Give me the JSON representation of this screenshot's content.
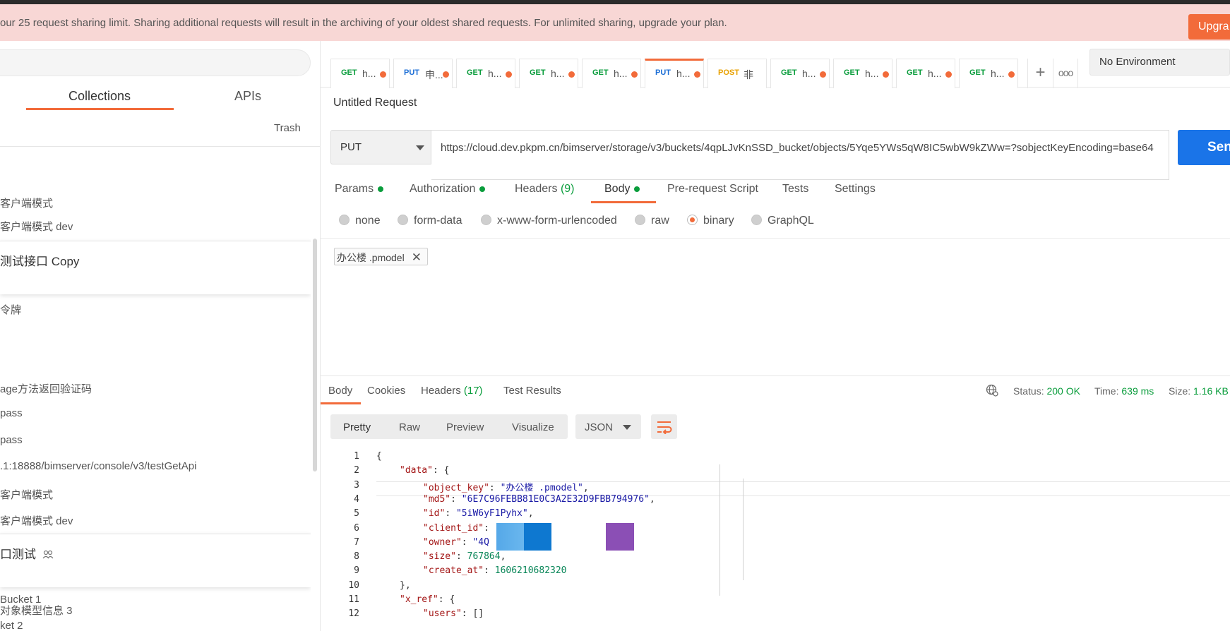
{
  "banner": {
    "text": "our 25 request sharing limit. Sharing additional requests will result in the archiving of your oldest shared requests. For unlimited sharing, upgrade your plan.",
    "upgrade_label": "Upgra"
  },
  "sidebar": {
    "tabs": [
      "Collections",
      "APIs"
    ],
    "trash_label": "Trash",
    "items": [
      "客户端模式",
      "客户端模式 dev",
      "令牌",
      "age方法返回验证码",
      "pass",
      "pass",
      ".1:18888/bimserver/console/v3/testGetApi",
      "客户端模式",
      "客户端模式 dev",
      "Bucket 1",
      "ket 2",
      "对象模型信息 3"
    ],
    "groups": [
      "测试接口 Copy",
      "口测试"
    ]
  },
  "tabs": {
    "items": [
      {
        "method": "GET",
        "title": "h..."
      },
      {
        "method": "PUT",
        "title": "申..."
      },
      {
        "method": "GET",
        "title": "h..."
      },
      {
        "method": "GET",
        "title": "h..."
      },
      {
        "method": "GET",
        "title": "h..."
      },
      {
        "method": "PUT",
        "title": "h..."
      },
      {
        "method": "POST",
        "title": "非"
      },
      {
        "method": "GET",
        "title": "h..."
      },
      {
        "method": "GET",
        "title": "h..."
      },
      {
        "method": "GET",
        "title": "h..."
      },
      {
        "method": "GET",
        "title": "h..."
      }
    ],
    "plus": "+",
    "more": "ooo"
  },
  "environment": {
    "selected": "No Environment"
  },
  "request": {
    "name": "Untitled Request",
    "method": "PUT",
    "url": "https://cloud.dev.pkpm.cn/bimserver/storage/v3/buckets/4qpLJvKnSSD_bucket/objects/5Yqe5YWs5qW8IC5wbW9kZWw=?sobjectKeyEncoding=base64",
    "send_label": "Send"
  },
  "subtabs": {
    "params": "Params",
    "authorization": "Authorization",
    "headers": "Headers",
    "headers_count": "(9)",
    "body": "Body",
    "prerequest": "Pre-request Script",
    "tests": "Tests",
    "settings": "Settings"
  },
  "body_types": [
    "none",
    "form-data",
    "x-www-form-urlencoded",
    "raw",
    "binary",
    "GraphQL"
  ],
  "file": {
    "name": "办公楼 .pmodel"
  },
  "response": {
    "tabs": {
      "body": "Body",
      "cookies": "Cookies",
      "headers": "Headers",
      "headers_count": "(17)",
      "test_results": "Test Results"
    },
    "status_label": "Status:",
    "status_value": "200 OK",
    "time_label": "Time:",
    "time_value": "639 ms",
    "size_label": "Size:",
    "size_value": "1.16 KB",
    "views": [
      "Pretty",
      "Raw",
      "Preview",
      "Visualize"
    ],
    "format": "JSON",
    "lines": [
      {
        "n": "1",
        "indent": 0,
        "parts": [
          [
            "p",
            "{"
          ]
        ]
      },
      {
        "n": "2",
        "indent": 1,
        "parts": [
          [
            "k",
            "\"data\""
          ],
          [
            "p",
            ": {"
          ]
        ]
      },
      {
        "n": "3",
        "indent": 2,
        "parts": [
          [
            "k",
            "\"object_key\""
          ],
          [
            "p",
            ": "
          ],
          [
            "s",
            "\"办公楼 .pmodel\""
          ],
          [
            "p",
            ","
          ]
        ]
      },
      {
        "n": "4",
        "indent": 2,
        "parts": [
          [
            "k",
            "\"md5\""
          ],
          [
            "p",
            ": "
          ],
          [
            "s",
            "\"6E7C96FEBB81E0C3A2E32D9FBB794976\""
          ],
          [
            "p",
            ","
          ]
        ]
      },
      {
        "n": "5",
        "indent": 2,
        "parts": [
          [
            "k",
            "\"id\""
          ],
          [
            "p",
            ": "
          ],
          [
            "s",
            "\"5iW6yF1Pyhx\""
          ],
          [
            "p",
            ","
          ]
        ]
      },
      {
        "n": "6",
        "indent": 2,
        "parts": [
          [
            "k",
            "\"client_id\""
          ],
          [
            "p",
            ":                     \","
          ]
        ]
      },
      {
        "n": "7",
        "indent": 2,
        "parts": [
          [
            "k",
            "\"owner\""
          ],
          [
            "p",
            ": "
          ],
          [
            "s",
            "\"4Q"
          ],
          [
            "p",
            "                     ,"
          ]
        ]
      },
      {
        "n": "8",
        "indent": 2,
        "parts": [
          [
            "k",
            "\"size\""
          ],
          [
            "p",
            ": "
          ],
          [
            "n",
            "767864"
          ],
          [
            "p",
            ","
          ]
        ]
      },
      {
        "n": "9",
        "indent": 2,
        "parts": [
          [
            "k",
            "\"create_at\""
          ],
          [
            "p",
            ": "
          ],
          [
            "n",
            "1606210682320"
          ]
        ]
      },
      {
        "n": "10",
        "indent": 1,
        "parts": [
          [
            "p",
            "},"
          ]
        ]
      },
      {
        "n": "11",
        "indent": 1,
        "parts": [
          [
            "k",
            "\"x_ref\""
          ],
          [
            "p",
            ": {"
          ]
        ]
      },
      {
        "n": "12",
        "indent": 2,
        "parts": [
          [
            "k",
            "\"users\""
          ],
          [
            "p",
            ": []"
          ]
        ]
      }
    ]
  }
}
